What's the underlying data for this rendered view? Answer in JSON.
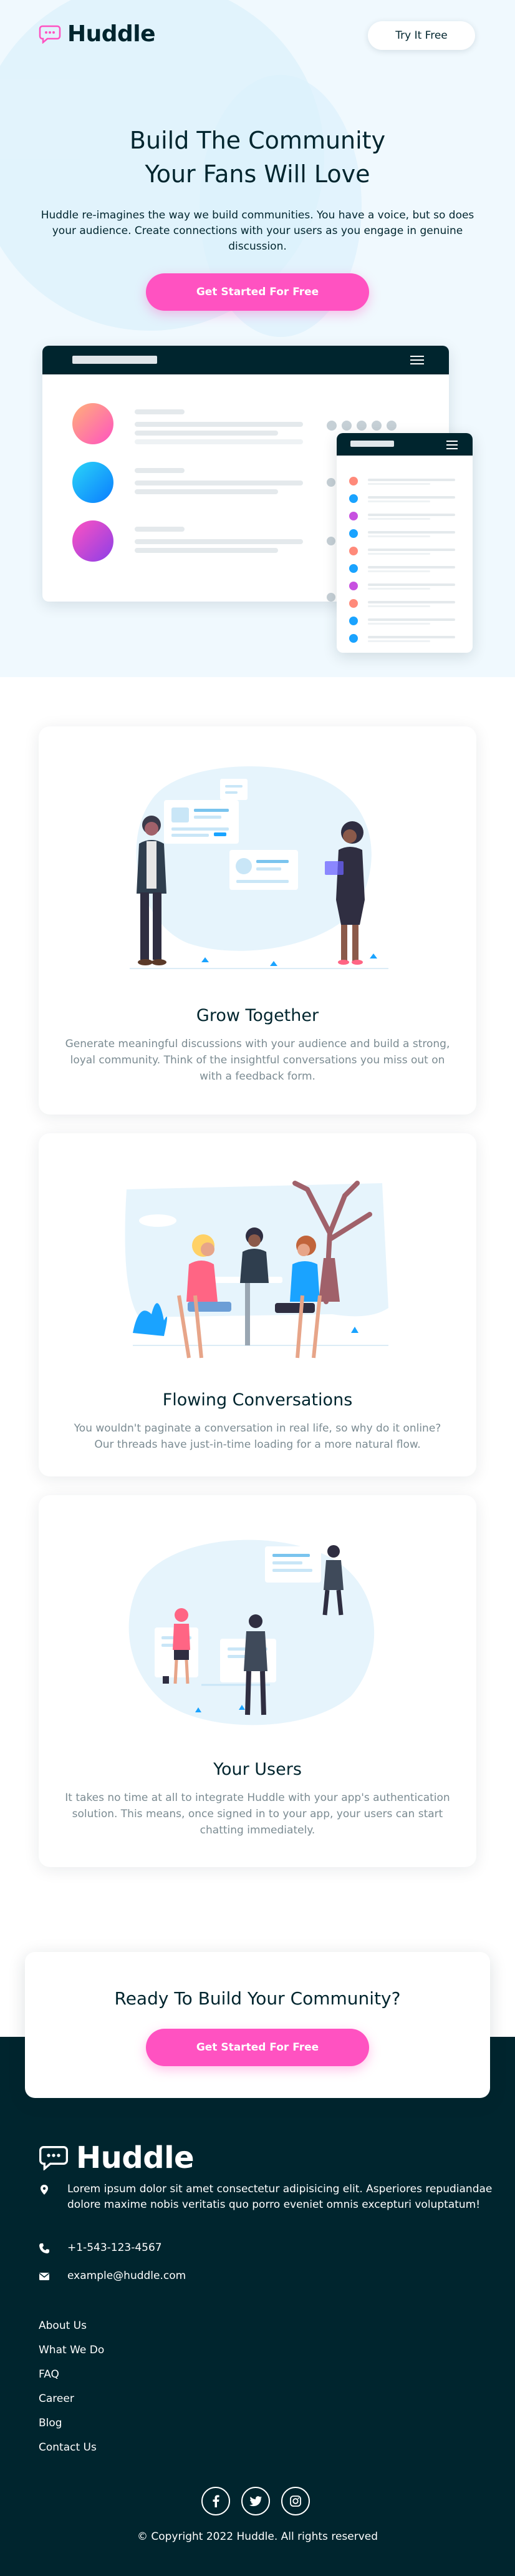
{
  "brand": {
    "name": "Huddle",
    "accent": "#ff52c1",
    "dark": "#00252e"
  },
  "header": {
    "try_label": "Try It Free"
  },
  "hero": {
    "title_line1": "Build The Community",
    "title_line2": "Your Fans Will Love",
    "description": "Huddle re-imagines the way we build communities. You have a voice, but so does your audience. Create connections with your users as you engage in genuine discussion.",
    "cta_label": "Get Started For Free"
  },
  "features": [
    {
      "title": "Grow Together",
      "description": "Generate meaningful discussions with your audience and build a strong, loyal community. Think of the insightful conversations you miss out on with a feedback form.",
      "illustration": "grow-together-illustration"
    },
    {
      "title": "Flowing Conversations",
      "description": "You wouldn't paginate a conversation in real life, so why do it online? Our threads have just-in-time loading for a more natural flow.",
      "illustration": "flowing-conversations-illustration"
    },
    {
      "title": "Your Users",
      "description": "It takes no time at all to integrate Huddle with your app's authentication solution. This means, once signed in to your app, your users can start chatting immediately.",
      "illustration": "your-users-illustration"
    }
  ],
  "cta": {
    "title": "Ready To Build Your Community?",
    "button_label": "Get Started For Free"
  },
  "footer": {
    "address": "Lorem ipsum dolor sit amet consectetur adipisicing elit. Asperiores repudiandae dolore maxime nobis veritatis quo porro eveniet omnis excepturi voluptatum!",
    "phone": "+1-543-123-4567",
    "email": "example@huddle.com",
    "links": [
      "About Us",
      "What We Do",
      "FAQ",
      "Career",
      "Blog",
      "Contact Us"
    ],
    "socials": [
      "facebook-icon",
      "twitter-icon",
      "instagram-icon"
    ],
    "copyright": "© Copyright 2022 Huddle. All rights reserved"
  }
}
